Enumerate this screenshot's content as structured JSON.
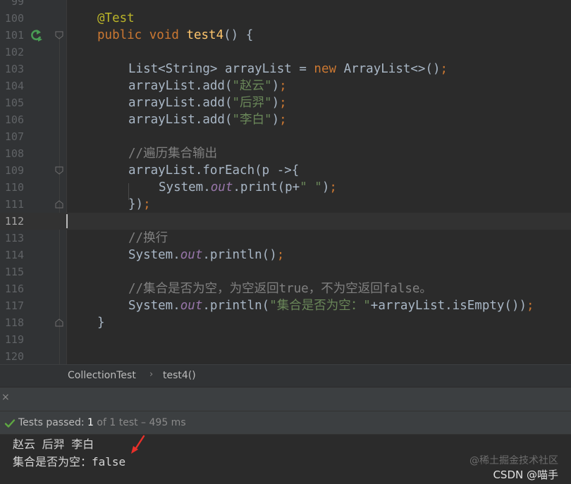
{
  "editor": {
    "lines": [
      {
        "num": "99",
        "tokens": []
      },
      {
        "num": "100",
        "tokens": [
          {
            "c": "ann",
            "t": "@Test"
          }
        ]
      },
      {
        "num": "101",
        "tokens": [
          {
            "c": "kw",
            "t": "public void "
          },
          {
            "c": "fn",
            "t": "test4"
          },
          {
            "c": "",
            "t": "() {"
          }
        ]
      },
      {
        "num": "102",
        "tokens": []
      },
      {
        "num": "103",
        "tokens": [
          {
            "c": "",
            "t": "List<String> arrayList = "
          },
          {
            "c": "kw",
            "t": "new "
          },
          {
            "c": "",
            "t": "ArrayList<>()"
          },
          {
            "c": "kw",
            "t": ";"
          }
        ]
      },
      {
        "num": "104",
        "tokens": [
          {
            "c": "",
            "t": "arrayList.add("
          },
          {
            "c": "str",
            "t": "\"赵云\""
          },
          {
            "c": "",
            "t": ")"
          },
          {
            "c": "kw",
            "t": ";"
          }
        ]
      },
      {
        "num": "105",
        "tokens": [
          {
            "c": "",
            "t": "arrayList.add("
          },
          {
            "c": "str",
            "t": "\"后羿\""
          },
          {
            "c": "",
            "t": ")"
          },
          {
            "c": "kw",
            "t": ";"
          }
        ]
      },
      {
        "num": "106",
        "tokens": [
          {
            "c": "",
            "t": "arrayList.add("
          },
          {
            "c": "str",
            "t": "\"李白\""
          },
          {
            "c": "",
            "t": ")"
          },
          {
            "c": "kw",
            "t": ";"
          }
        ]
      },
      {
        "num": "107",
        "tokens": []
      },
      {
        "num": "108",
        "tokens": [
          {
            "c": "cmt",
            "t": "//遍历集合输出"
          }
        ]
      },
      {
        "num": "109",
        "tokens": [
          {
            "c": "",
            "t": "arrayList.forEach(p ->{"
          }
        ]
      },
      {
        "num": "110",
        "tokens": [
          {
            "c": "",
            "t": "System."
          },
          {
            "c": "field",
            "t": "out"
          },
          {
            "c": "",
            "t": ".print(p+"
          },
          {
            "c": "str",
            "t": "\" \""
          },
          {
            "c": "",
            "t": ")"
          },
          {
            "c": "kw",
            "t": ";"
          }
        ]
      },
      {
        "num": "111",
        "tokens": [
          {
            "c": "",
            "t": "})"
          },
          {
            "c": "kw",
            "t": ";"
          }
        ]
      },
      {
        "num": "112",
        "tokens": []
      },
      {
        "num": "113",
        "tokens": [
          {
            "c": "cmt",
            "t": "//换行"
          }
        ]
      },
      {
        "num": "114",
        "tokens": [
          {
            "c": "",
            "t": "System."
          },
          {
            "c": "field",
            "t": "out"
          },
          {
            "c": "",
            "t": ".println()"
          },
          {
            "c": "kw",
            "t": ";"
          }
        ]
      },
      {
        "num": "115",
        "tokens": []
      },
      {
        "num": "116",
        "tokens": [
          {
            "c": "cmt",
            "t": "//集合是否为空，为空返回true，不为空返回false。"
          }
        ]
      },
      {
        "num": "117",
        "tokens": [
          {
            "c": "",
            "t": "System."
          },
          {
            "c": "field",
            "t": "out"
          },
          {
            "c": "",
            "t": ".println("
          },
          {
            "c": "str",
            "t": "\"集合是否为空：\""
          },
          {
            "c": "",
            "t": "+arrayList.isEmpty())"
          },
          {
            "c": "kw",
            "t": ";"
          }
        ]
      },
      {
        "num": "118",
        "tokens": [
          {
            "c": "",
            "t": "}"
          }
        ]
      },
      {
        "num": "119",
        "tokens": []
      },
      {
        "num": "120",
        "tokens": []
      }
    ]
  },
  "breadcrumb": {
    "class_name": "CollectionTest",
    "method_name": "test4()",
    "separator": "›"
  },
  "run_tabs": {
    "close_glyph": "×"
  },
  "status": {
    "passed_label": "Tests passed: ",
    "count": "1",
    "detail": " of 1 test – 495 ms"
  },
  "console": {
    "line1": "赵云 后羿 李白",
    "line2": "集合是否为空：false"
  },
  "watermark": {
    "line1": "@稀土掘金技术社区",
    "line2": "CSDN @喵手"
  },
  "colors": {
    "run_icon": "#499c54",
    "check": "#5fa842",
    "arrow": "#e8302a"
  }
}
